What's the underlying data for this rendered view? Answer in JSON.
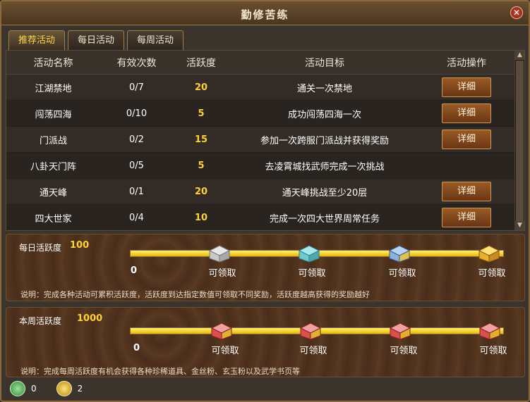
{
  "window": {
    "title": "勤修苦练"
  },
  "tabs": [
    {
      "label": "推荐活动"
    },
    {
      "label": "每日活动"
    },
    {
      "label": "每周活动"
    }
  ],
  "table": {
    "headers": [
      "活动名称",
      "有效次数",
      "活跃度",
      "活动目标",
      "活动操作"
    ],
    "rows": [
      {
        "name": "江湖禁地",
        "count": "0/7",
        "points": "20",
        "target": "通关一次禁地",
        "action": "详细"
      },
      {
        "name": "闯荡四海",
        "count": "0/10",
        "points": "5",
        "target": "成功闯荡四海一次",
        "action": "详细"
      },
      {
        "name": "门派战",
        "count": "0/2",
        "points": "15",
        "target": "参加一次跨服门派战并获得奖励",
        "action": "详细"
      },
      {
        "name": "八卦天门阵",
        "count": "0/5",
        "points": "5",
        "target": "去凌霄城找武师完成一次挑战",
        "action": ""
      },
      {
        "name": "通天峰",
        "count": "0/1",
        "points": "20",
        "target": "通天峰挑战至少20层",
        "action": "详细"
      },
      {
        "name": "四大世家",
        "count": "0/4",
        "points": "10",
        "target": "完成一次四大世界周常任务",
        "action": "详细"
      }
    ]
  },
  "daily": {
    "label": "每日活跃度",
    "value": "100",
    "progress": 1.0,
    "zero": "0",
    "chests": [
      {
        "label": "可领取",
        "color": "silver"
      },
      {
        "label": "可领取",
        "color": "cyan"
      },
      {
        "label": "可领取",
        "color": "blue"
      },
      {
        "label": "可领取",
        "color": "gold"
      }
    ],
    "note": "说明：完成各种活动可累积活跃度，活跃度到达指定数值可领取不同奖励，活跃度越高获得的奖励越好"
  },
  "weekly": {
    "label": "本周活跃度",
    "value": "1000",
    "progress": 1.0,
    "zero": "0",
    "chests": [
      {
        "label": "可领取",
        "color": "red"
      },
      {
        "label": "可领取",
        "color": "red"
      },
      {
        "label": "可领取",
        "color": "red"
      },
      {
        "label": "可领取",
        "color": "red"
      }
    ],
    "note": "说明：完成每周活跃度有机会获得各种珍稀道具、金丝粉、玄玉粉以及武学书页等"
  },
  "footer": {
    "jade_count": "0",
    "gold_count": "2"
  }
}
